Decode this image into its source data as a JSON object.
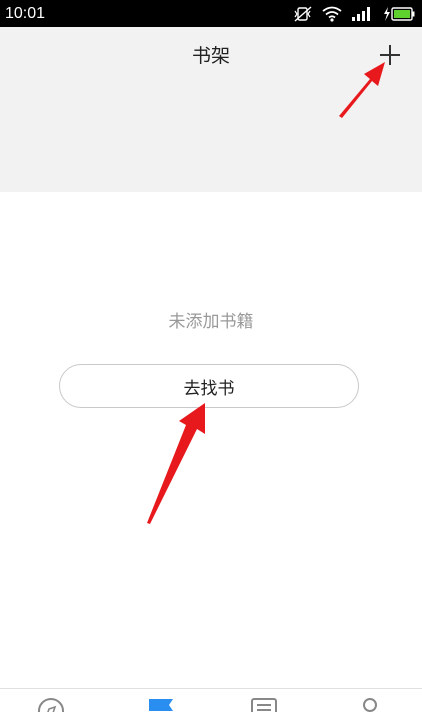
{
  "status_bar": {
    "time": "10:01",
    "icons": [
      "vibrate-off-icon",
      "wifi-icon",
      "signal-icon",
      "battery-charging-icon"
    ]
  },
  "header": {
    "title": "书架",
    "add_icon": "plus-icon"
  },
  "empty_state": {
    "message": "未添加书籍",
    "button_label": "去找书"
  },
  "bottom_nav": {
    "items": [
      {
        "icon": "compass-icon"
      },
      {
        "icon": "bookshelf-icon",
        "active": true
      },
      {
        "icon": "list-icon"
      },
      {
        "icon": "profile-icon"
      }
    ]
  },
  "colors": {
    "header_bg": "#f2f2f2",
    "accent": "#2a8ef0",
    "annotation_arrow": "#e8191c",
    "muted_text": "#999999"
  }
}
